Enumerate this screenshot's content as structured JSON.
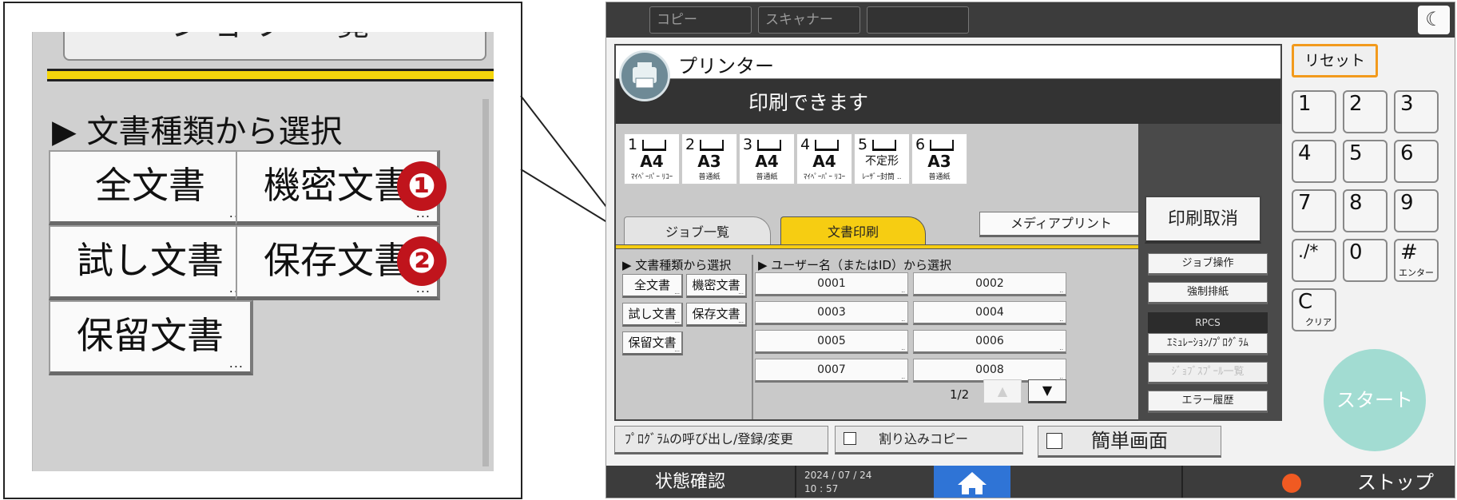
{
  "callout": {
    "tab_label": "ジョブ一覧",
    "section_title": "▶ 文書種類から選択",
    "buttons": [
      "全文書",
      "機密文書",
      "試し文書",
      "保存文書",
      "保留文書"
    ],
    "badges": [
      "❶",
      "❷"
    ],
    "more_dots": "..."
  },
  "device": {
    "top_tabs": [
      "コピー",
      "スキャナー",
      ""
    ],
    "moon_icon": "☾",
    "app_title": "プリンター",
    "status_text": "印刷できます",
    "trays": [
      {
        "num": "1",
        "size": "A4",
        "type": "ﾏｲﾍﾟｰﾊﾟｰ ﾘｺｰ"
      },
      {
        "num": "2",
        "size": "A3",
        "type": "普通紙"
      },
      {
        "num": "3",
        "size": "A4",
        "type": "普通紙"
      },
      {
        "num": "4",
        "size": "A4",
        "type": "ﾏｲﾍﾟｰﾊﾟｰ ﾘｺｰ"
      },
      {
        "num": "5",
        "size": "不定形",
        "type": "ﾚｰｻﾞｰ封筒 .."
      },
      {
        "num": "6",
        "size": "A3",
        "type": "普通紙"
      }
    ],
    "tabs": {
      "job_list": "ジョブ一覧",
      "doc_print": "文書印刷"
    },
    "media_print": "メディアプリント",
    "doc_type_title": "▶ 文書種類から選択",
    "user_title": "▶ ユーザー名（またはID）から選択",
    "doc_buttons": [
      "全文書",
      "機密文書",
      "試し文書",
      "保存文書",
      "保留文書"
    ],
    "users": [
      "0001",
      "0002",
      "0003",
      "0004",
      "0005",
      "0006",
      "0007",
      "0008"
    ],
    "page_indicator": "1/2",
    "page_up": "▲",
    "page_down": "▼",
    "right": {
      "cancel_print": "印刷取消",
      "job_ops": "ジョブ操作",
      "force_eject": "強制排紙",
      "rpcs": "RPCS",
      "emulation": "ｴﾐｭﾚｰｼｮﾝ/ﾌﾟﾛｸﾞﾗﾑ",
      "spool": "ｼﾞｮﾌﾞｽﾌﾟｰﾙ一覧",
      "error_log": "エラー履歴"
    },
    "program_recall": "ﾌﾟﾛｸﾞﾗﾑの呼び出し/登録/変更",
    "interrupt_copy": "割り込みコピー",
    "simple_screen": "簡単画面",
    "reset": "リセット",
    "keys": [
      {
        "main": "1",
        "sub": ""
      },
      {
        "main": "2",
        "sub": ""
      },
      {
        "main": "3",
        "sub": ""
      },
      {
        "main": "4",
        "sub": ""
      },
      {
        "main": "5",
        "sub": ""
      },
      {
        "main": "6",
        "sub": ""
      },
      {
        "main": "7",
        "sub": ""
      },
      {
        "main": "8",
        "sub": ""
      },
      {
        "main": "9",
        "sub": ""
      },
      {
        "main": "./*",
        "sub": ""
      },
      {
        "main": "0",
        "sub": ""
      },
      {
        "main": "#",
        "sub": "エンター"
      },
      {
        "main": "C",
        "sub": "クリア"
      }
    ],
    "start": "スタート",
    "bottom": {
      "status_check": "状態確認",
      "date": "2024 / 07 / 24",
      "time": "10 : 57",
      "stop": "ストップ"
    }
  },
  "colors": {
    "accent_yellow": "#f6cd12",
    "badge_red": "#c0141c",
    "reset_orange": "#f29a1d",
    "home_blue": "#2f74d6",
    "start_mint": "#a2dcd2"
  }
}
